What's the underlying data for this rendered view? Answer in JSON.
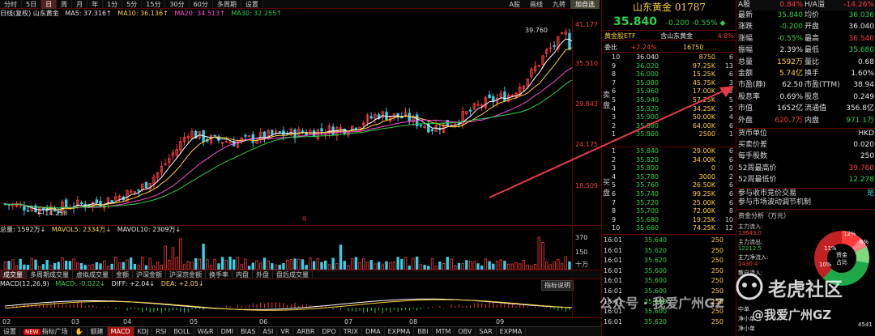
{
  "toolbar": {
    "periods": [
      "分时",
      "5日",
      "日",
      "周",
      "月",
      "年",
      "1分",
      "5分",
      "15分",
      "30分",
      "60分",
      "多周期",
      "设置"
    ],
    "active_period": "日",
    "right_items": [
      "A股",
      "画线",
      "九转",
      "加自选"
    ],
    "right_active": "加自选"
  },
  "ma_legend": {
    "label": "日线(复权) 山东黄金",
    "ma5": "MA5: 37.316↑",
    "ma10": "MA10: 36.136↑",
    "ma20": "MA20: 34.513↑",
    "ma30": "MA30: 32.255↑"
  },
  "kline": {
    "y_ticks": [
      "41.177",
      "35.510",
      "29.843",
      "24.175",
      "18.509"
    ],
    "high_label": "39.760",
    "low_label": "14.258",
    "q_label": "q",
    "colors": {
      "up": "#ff3b3b",
      "down": "#35d0e8",
      "ma5": "#ffffff",
      "ma10": "#ffd23a",
      "ma20": "#ff4bd8",
      "ma30": "#2fd24a"
    }
  },
  "volume": {
    "legend_total": "总量: 1592万↓",
    "mavol5": "MAVOL5: 2334万↓",
    "mavol10": "MAVOL10: 2309万↓",
    "y_ticks": [
      "370",
      "150",
      "十万"
    ]
  },
  "indicator_tabs": [
    "成交量",
    "多周期成交量",
    "虚拟成交量",
    "金额",
    "沪深金额",
    "沪深京金额",
    "换手率",
    "内盘",
    "外盘",
    "盘后成交量"
  ],
  "indicator_active": "成交量",
  "macd": {
    "label": "MACD(12,26,9)",
    "macd_val": "MACD: -0.022↓",
    "diff": "DIFF: +2.04↓",
    "dea": "DEA: +2.05↓",
    "button": "指标说明"
  },
  "dates": [
    "02",
    "03",
    "04",
    "05",
    "06",
    "07",
    "08",
    "09"
  ],
  "bottom_bar": {
    "items": [
      "设置",
      "指标广场",
      "✋",
      "额建",
      "MACD",
      "KDJ",
      "RSI",
      "BOLL",
      "W&R",
      "DMI",
      "BIAS",
      "ASI",
      "VR",
      "ARBR",
      "DPO",
      "TRIX",
      "DMA",
      "EXPMA",
      "BBI",
      "MTM",
      "OBV",
      "SAR",
      "EXPMA"
    ],
    "active": "MACD",
    "new_tag": "NEW"
  },
  "book": {
    "title": "山东黄金 01787",
    "price": "35.840",
    "change": "-0.200",
    "change_pct": "-0.55%",
    "arrow": "◆",
    "etf_name": "黄金股ETF",
    "etf_holding": "含山东黄金",
    "etf_pct": "4.8%",
    "webi_label": "委比",
    "webi_pct": "+2.24%",
    "webi_vol": "16750",
    "sell_label": "卖盘",
    "buy_label": "买盘",
    "asks": [
      {
        "lv": "10",
        "p": "36.040",
        "v": "8750",
        "c": "6"
      },
      {
        "lv": "9",
        "p": "36.020",
        "v": "97.25K",
        "c": "13"
      },
      {
        "lv": "8",
        "p": "36.000",
        "v": "15.25K",
        "c": "6"
      },
      {
        "lv": "7",
        "p": "35.980",
        "v": "45.75K",
        "c": "3"
      },
      {
        "lv": "6",
        "p": "35.960",
        "v": "17.00K",
        "c": "2"
      },
      {
        "lv": "5",
        "p": "35.940",
        "v": "57.25K",
        "c": "5"
      },
      {
        "lv": "4",
        "p": "35.920",
        "v": "34.25K",
        "c": "5"
      },
      {
        "lv": "3",
        "p": "35.900",
        "v": "50.00K",
        "c": "4"
      },
      {
        "lv": "2",
        "p": "35.880",
        "v": "64.00K",
        "c": "6"
      },
      {
        "lv": "1",
        "p": "35.860",
        "v": "2500",
        "c": "1"
      }
    ],
    "bids": [
      {
        "lv": "1",
        "p": "35.840",
        "v": "29.00K",
        "c": "6"
      },
      {
        "lv": "2",
        "p": "35.820",
        "v": "34.00K",
        "c": "6"
      },
      {
        "lv": "3",
        "p": "35.800",
        "v": "0",
        "c": "0"
      },
      {
        "lv": "4",
        "p": "35.780",
        "v": "3000",
        "c": "2"
      },
      {
        "lv": "5",
        "p": "35.760",
        "v": "26.50K",
        "c": "6"
      },
      {
        "lv": "6",
        "p": "35.740",
        "v": "99.25K",
        "c": "6"
      },
      {
        "lv": "7",
        "p": "35.720",
        "v": "25.00K",
        "c": "6"
      },
      {
        "lv": "8",
        "p": "35.700",
        "v": "72.00K",
        "c": "8"
      },
      {
        "lv": "9",
        "p": "35.680",
        "v": "19.25K",
        "c": "10"
      },
      {
        "lv": "10",
        "p": "35.660",
        "v": "74.25K",
        "c": "12"
      }
    ],
    "trades": [
      {
        "t": "16:01",
        "p": "35.640",
        "v": "250"
      },
      {
        "t": "16:01",
        "p": "35.620",
        "v": "250"
      },
      {
        "t": "16:01",
        "p": "35.620",
        "v": "250"
      },
      {
        "t": "16:01",
        "p": "35.600",
        "v": "250"
      },
      {
        "t": "16:01",
        "p": "35.600",
        "v": "250"
      },
      {
        "t": "16:01",
        "p": "35.600",
        "v": "250"
      },
      {
        "t": "16:01",
        "p": "35.600",
        "v": "250"
      },
      {
        "t": "16:01",
        "p": "35.600",
        "v": "250"
      },
      {
        "t": "16:01",
        "p": "35.620",
        "v": "250"
      }
    ]
  },
  "quote": {
    "header": {
      "l1": "A股",
      "v1": "0.84%",
      "l2": "H/A溢",
      "v2": "-14.26%"
    },
    "rows": [
      {
        "l1": "最新",
        "v1": "35.840",
        "l2": "均价",
        "v2": "36.036",
        "c1": "green",
        "c2": "green"
      },
      {
        "l1": "涨跌",
        "v1": "-0.200",
        "l2": "开盘",
        "v2": "36.040",
        "c1": "green",
        "c2": "white"
      },
      {
        "l1": "涨幅",
        "v1": "-0.55%",
        "l2": "最高",
        "v2": "36.540",
        "c1": "green",
        "c2": "red"
      },
      {
        "l1": "振幅",
        "v1": "2.39%",
        "l2": "最低",
        "v2": "35.680",
        "c1": "white",
        "c2": "green"
      },
      {
        "l1": "总量",
        "v1": "1592万",
        "l2": "量比",
        "v2": "0.68",
        "c1": "yellow",
        "c2": "white"
      },
      {
        "l1": "金额",
        "v1": "5.74亿",
        "l2": "换手",
        "v2": "1.60%",
        "c1": "yellow",
        "c2": "white"
      },
      {
        "l1": "市盈(静)",
        "v1": "62.50",
        "l2": "市盈(TTM)",
        "v2": "38.94",
        "c1": "white",
        "c2": "white"
      },
      {
        "l1": "股息率",
        "v1": "0.69%",
        "l2": "股息",
        "v2": "0.249",
        "c1": "white",
        "c2": "white"
      },
      {
        "l1": "市值",
        "v1": "1652亿",
        "l2": "流通值",
        "v2": "356.8亿",
        "c1": "white",
        "c2": "white"
      },
      {
        "l1": "外盘",
        "v1": "620.7万",
        "l2": "内盘",
        "v2": "971.1万",
        "c1": "red",
        "c2": "green"
      }
    ],
    "single_rows": [
      {
        "l": "货币单位",
        "v": "HKD",
        "c": "white"
      },
      {
        "l": "买卖价差",
        "v": "0.020",
        "c": "white"
      },
      {
        "l": "每手股数",
        "v": "250",
        "c": "white"
      },
      {
        "l": "52周最高价",
        "v": "39.760",
        "c": "red"
      },
      {
        "l": "52周最低价",
        "v": "12.278",
        "c": "green"
      }
    ],
    "auction1": "参与收市竞价交易",
    "auction2": "参与市场波动调节机制",
    "auction_flag": "是",
    "capital_flow": "资金分析（万元）",
    "main_in_label": "主力流入:",
    "main_in": "13643.0",
    "main_out_label": "主力流出:",
    "main_out": "12212.5",
    "main_net_label": "主力净流入:",
    "main_net": "1430.4",
    "retail_in_label": "散户流入:",
    "donut_center": "资金\n占比",
    "donut_pcts": [
      "12%",
      "6%",
      "11%",
      "10%"
    ],
    "side_labels": [
      "中单",
      "净小单",
      "净小单"
    ],
    "side_val": "4541"
  },
  "watermark": {
    "brand": "老虎社区",
    "wechat": "公众号 · 我爱广州GZ",
    "handle": "@我爱广州GZ"
  }
}
